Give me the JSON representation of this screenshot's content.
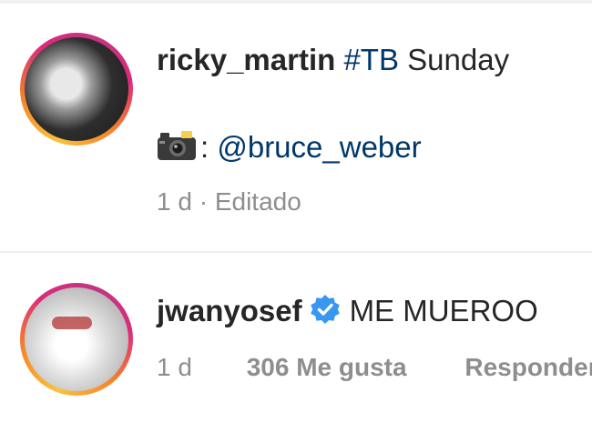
{
  "caption": {
    "username": "ricky_martin",
    "hashtag": "#TB",
    "text": "Sunday",
    "credit_separator": ":",
    "credit_mention": "@bruce_weber",
    "time": "1 d",
    "separator": "·",
    "edited_label": "Editado"
  },
  "comment": {
    "username": "jwanyosef",
    "verified": true,
    "text": "ME MUEROO",
    "time": "1 d",
    "likes": "306 Me gusta",
    "reply_label": "Responder"
  },
  "colors": {
    "text": "#262626",
    "link": "#00376b",
    "meta": "#8e8e8e",
    "verified": "#3897f0"
  },
  "icons": {
    "camera": "camera-with-flash-icon",
    "verified": "verified-badge-icon"
  }
}
